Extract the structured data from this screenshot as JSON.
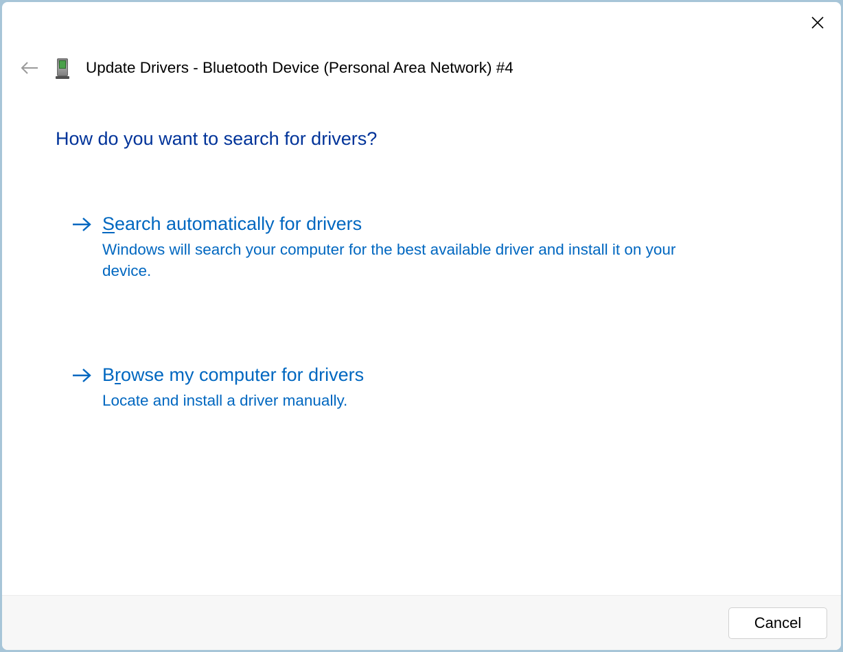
{
  "header": {
    "title": "Update Drivers - Bluetooth Device (Personal Area Network) #4"
  },
  "heading": "How do you want to search for drivers?",
  "options": [
    {
      "title_pre": "",
      "title_accel": "S",
      "title_post": "earch automatically for drivers",
      "desc": "Windows will search your computer for the best available driver and install it on your device."
    },
    {
      "title_pre": "B",
      "title_accel": "r",
      "title_post": "owse my computer for drivers",
      "desc": "Locate and install a driver manually."
    }
  ],
  "footer": {
    "cancel_label": "Cancel"
  }
}
